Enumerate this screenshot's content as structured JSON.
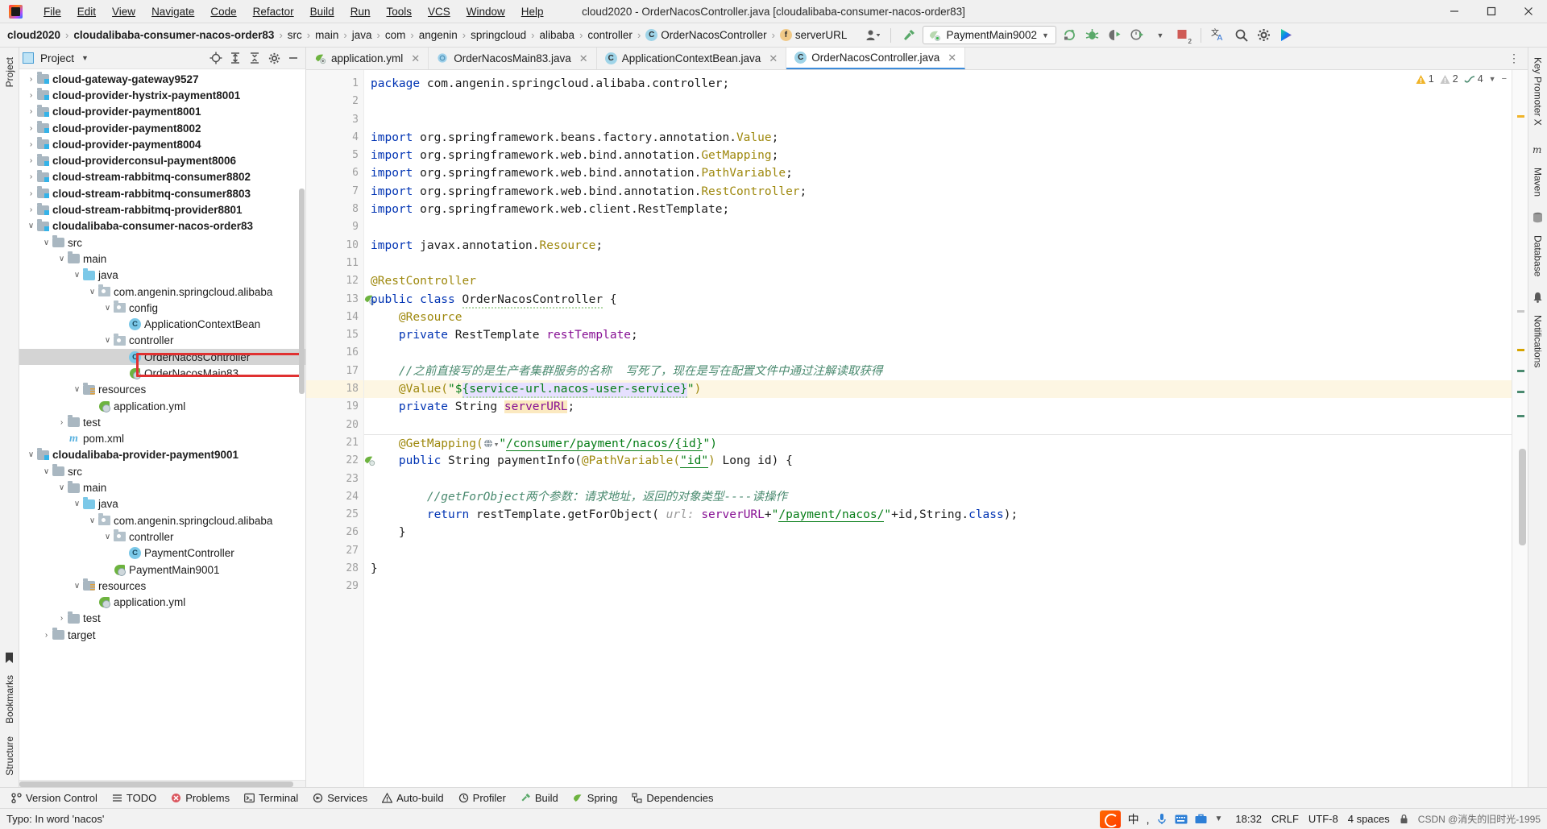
{
  "window": {
    "title": "cloud2020 - OrderNacosController.java [cloudalibaba-consumer-nacos-order83]",
    "minimize": "minimize-icon",
    "maximize": "maximize-icon",
    "close": "close-icon"
  },
  "menu": [
    {
      "label": "File"
    },
    {
      "label": "Edit"
    },
    {
      "label": "View"
    },
    {
      "label": "Navigate"
    },
    {
      "label": "Code"
    },
    {
      "label": "Refactor"
    },
    {
      "label": "Build"
    },
    {
      "label": "Run"
    },
    {
      "label": "Tools"
    },
    {
      "label": "VCS"
    },
    {
      "label": "Window"
    },
    {
      "label": "Help"
    }
  ],
  "breadcrumbs": [
    {
      "label": "cloud2020",
      "bold": true,
      "icon": ""
    },
    {
      "label": "cloudalibaba-consumer-nacos-order83",
      "bold": true,
      "icon": ""
    },
    {
      "label": "src",
      "bold": false,
      "icon": ""
    },
    {
      "label": "main",
      "bold": false,
      "icon": ""
    },
    {
      "label": "java",
      "bold": false,
      "icon": ""
    },
    {
      "label": "com",
      "bold": false,
      "icon": ""
    },
    {
      "label": "angenin",
      "bold": false,
      "icon": ""
    },
    {
      "label": "springcloud",
      "bold": false,
      "icon": ""
    },
    {
      "label": "alibaba",
      "bold": false,
      "icon": ""
    },
    {
      "label": "controller",
      "bold": false,
      "icon": ""
    },
    {
      "label": "OrderNacosController",
      "bold": false,
      "icon": "class-badge",
      "badge": "C"
    },
    {
      "label": "serverURL",
      "bold": false,
      "icon": "field-badge",
      "badge": "f"
    }
  ],
  "toolbar": {
    "run_config": "PaymentMain9002",
    "icons": [
      "user-avatar-icon",
      "hammer-build-icon",
      "rerun-icon",
      "debug-icon",
      "coverage-icon",
      "profiler-icon",
      "dropdown-arrow-icon",
      "stop-icon",
      "translate-icon",
      "search-icon",
      "settings-gear-icon",
      "ide-feature-icon"
    ],
    "stop_badge": "2"
  },
  "project_panel": {
    "title": "Project",
    "header_icons": [
      "locate-icon",
      "expand-all-icon",
      "collapse-all-icon",
      "settings-gear-icon",
      "hide-icon"
    ]
  },
  "tree": [
    {
      "depth": 1,
      "arrow": "›",
      "icon": "module-icon",
      "label": "cloud-gateway-gateway9527",
      "bold": true
    },
    {
      "depth": 1,
      "arrow": "›",
      "icon": "module-icon",
      "label": "cloud-provider-hystrix-payment8001",
      "bold": true
    },
    {
      "depth": 1,
      "arrow": "›",
      "icon": "module-icon",
      "label": "cloud-provider-payment8001",
      "bold": true
    },
    {
      "depth": 1,
      "arrow": "›",
      "icon": "module-icon",
      "label": "cloud-provider-payment8002",
      "bold": true
    },
    {
      "depth": 1,
      "arrow": "›",
      "icon": "module-icon",
      "label": "cloud-provider-payment8004",
      "bold": true
    },
    {
      "depth": 1,
      "arrow": "›",
      "icon": "module-icon",
      "label": "cloud-providerconsul-payment8006",
      "bold": true
    },
    {
      "depth": 1,
      "arrow": "›",
      "icon": "module-icon",
      "label": "cloud-stream-rabbitmq-consumer8802",
      "bold": true
    },
    {
      "depth": 1,
      "arrow": "›",
      "icon": "module-icon",
      "label": "cloud-stream-rabbitmq-consumer8803",
      "bold": true
    },
    {
      "depth": 1,
      "arrow": "›",
      "icon": "module-icon",
      "label": "cloud-stream-rabbitmq-provider8801",
      "bold": true
    },
    {
      "depth": 1,
      "arrow": "∨",
      "icon": "module-icon",
      "label": "cloudalibaba-consumer-nacos-order83",
      "bold": true
    },
    {
      "depth": 2,
      "arrow": "∨",
      "icon": "folder-icon",
      "label": "src",
      "bold": false
    },
    {
      "depth": 3,
      "arrow": "∨",
      "icon": "folder-icon",
      "label": "main",
      "bold": false
    },
    {
      "depth": 4,
      "arrow": "∨",
      "icon": "source-folder-icon",
      "label": "java",
      "bold": false
    },
    {
      "depth": 5,
      "arrow": "∨",
      "icon": "package-icon",
      "label": "com.angenin.springcloud.alibaba",
      "bold": false
    },
    {
      "depth": 6,
      "arrow": "∨",
      "icon": "package-icon",
      "label": "config",
      "bold": false
    },
    {
      "depth": 7,
      "arrow": "",
      "icon": "class-icon",
      "label": "ApplicationContextBean",
      "bold": false
    },
    {
      "depth": 6,
      "arrow": "∨",
      "icon": "package-icon",
      "label": "controller",
      "bold": false
    },
    {
      "depth": 7,
      "arrow": "",
      "icon": "class-icon",
      "label": "OrderNacosController",
      "bold": false,
      "selected": true,
      "highlighted": true
    },
    {
      "depth": 7,
      "arrow": "",
      "icon": "spring-class-icon",
      "label": "OrderNacosMain83",
      "bold": false
    },
    {
      "depth": 4,
      "arrow": "∨",
      "icon": "resource-folder-icon",
      "label": "resources",
      "bold": false
    },
    {
      "depth": 5,
      "arrow": "",
      "icon": "spring-yml-icon",
      "label": "application.yml",
      "bold": false
    },
    {
      "depth": 3,
      "arrow": "›",
      "icon": "folder-icon",
      "label": "test",
      "bold": false
    },
    {
      "depth": 3,
      "arrow": "",
      "icon": "maven-icon",
      "label": "pom.xml",
      "bold": false
    },
    {
      "depth": 1,
      "arrow": "∨",
      "icon": "module-icon",
      "label": "cloudalibaba-provider-payment9001",
      "bold": true
    },
    {
      "depth": 2,
      "arrow": "∨",
      "icon": "folder-icon",
      "label": "src",
      "bold": false
    },
    {
      "depth": 3,
      "arrow": "∨",
      "icon": "folder-icon",
      "label": "main",
      "bold": false
    },
    {
      "depth": 4,
      "arrow": "∨",
      "icon": "source-folder-icon",
      "label": "java",
      "bold": false
    },
    {
      "depth": 5,
      "arrow": "∨",
      "icon": "package-icon",
      "label": "com.angenin.springcloud.alibaba",
      "bold": false
    },
    {
      "depth": 6,
      "arrow": "∨",
      "icon": "package-icon",
      "label": "controller",
      "bold": false
    },
    {
      "depth": 7,
      "arrow": "",
      "icon": "class-icon",
      "label": "PaymentController",
      "bold": false
    },
    {
      "depth": 6,
      "arrow": "",
      "icon": "spring-class-icon",
      "label": "PaymentMain9001",
      "bold": false
    },
    {
      "depth": 4,
      "arrow": "∨",
      "icon": "resource-folder-icon",
      "label": "resources",
      "bold": false
    },
    {
      "depth": 5,
      "arrow": "",
      "icon": "spring-yml-icon",
      "label": "application.yml",
      "bold": false
    },
    {
      "depth": 3,
      "arrow": "›",
      "icon": "folder-icon",
      "label": "test",
      "bold": false
    },
    {
      "depth": 2,
      "arrow": "›",
      "icon": "folder-icon",
      "label": "target",
      "bold": false
    }
  ],
  "editor_tabs": [
    {
      "label": "application.yml",
      "icon": "spring-yml-icon",
      "active": false
    },
    {
      "label": "OrderNacosMain83.java",
      "icon": "spring-class-icon",
      "active": false
    },
    {
      "label": "ApplicationContextBean.java",
      "icon": "class-icon",
      "active": false
    },
    {
      "label": "OrderNacosController.java",
      "icon": "class-icon",
      "active": true
    }
  ],
  "analysis": {
    "warnings": "1",
    "weak_warnings": "2",
    "typos": "4"
  },
  "code": {
    "lines": [
      {
        "n": "1",
        "indent": 0,
        "gutter": "",
        "tokens": [
          {
            "t": "package ",
            "c": "k"
          },
          {
            "t": "com.angenin.springcloud.alibaba.controller;",
            "c": ""
          }
        ]
      },
      {
        "n": "2",
        "indent": 0,
        "gutter": "",
        "tokens": []
      },
      {
        "n": "3",
        "indent": 0,
        "gutter": "",
        "tokens": []
      },
      {
        "n": "4",
        "indent": 0,
        "gutter": "fold",
        "tokens": [
          {
            "t": "import ",
            "c": "k"
          },
          {
            "t": "org.springframework.beans.factory.annotation.",
            "c": ""
          },
          {
            "t": "Value",
            "c": "goldc"
          },
          {
            "t": ";",
            "c": ""
          }
        ]
      },
      {
        "n": "5",
        "indent": 0,
        "gutter": "",
        "tokens": [
          {
            "t": "import ",
            "c": "k"
          },
          {
            "t": "org.springframework.web.bind.annotation.",
            "c": ""
          },
          {
            "t": "GetMapping",
            "c": "goldc"
          },
          {
            "t": ";",
            "c": ""
          }
        ]
      },
      {
        "n": "6",
        "indent": 0,
        "gutter": "",
        "tokens": [
          {
            "t": "import ",
            "c": "k"
          },
          {
            "t": "org.springframework.web.bind.annotation.",
            "c": ""
          },
          {
            "t": "PathVariable",
            "c": "goldc"
          },
          {
            "t": ";",
            "c": ""
          }
        ]
      },
      {
        "n": "7",
        "indent": 0,
        "gutter": "",
        "tokens": [
          {
            "t": "import ",
            "c": "k"
          },
          {
            "t": "org.springframework.web.bind.annotation.",
            "c": ""
          },
          {
            "t": "RestController",
            "c": "goldc"
          },
          {
            "t": ";",
            "c": ""
          }
        ]
      },
      {
        "n": "8",
        "indent": 0,
        "gutter": "",
        "tokens": [
          {
            "t": "import ",
            "c": "k"
          },
          {
            "t": "org.springframework.web.client.RestTemplate;",
            "c": ""
          }
        ]
      },
      {
        "n": "9",
        "indent": 0,
        "gutter": "",
        "tokens": []
      },
      {
        "n": "10",
        "indent": 0,
        "gutter": "fold",
        "tokens": [
          {
            "t": "import ",
            "c": "k"
          },
          {
            "t": "javax.annotation.",
            "c": ""
          },
          {
            "t": "Resource",
            "c": "goldc"
          },
          {
            "t": ";",
            "c": ""
          }
        ]
      },
      {
        "n": "11",
        "indent": 0,
        "gutter": "",
        "tokens": []
      },
      {
        "n": "12",
        "indent": 0,
        "gutter": "",
        "tokens": [
          {
            "t": "@RestController",
            "c": "ann"
          }
        ]
      },
      {
        "n": "13",
        "indent": 0,
        "gutter": "spring",
        "tokens": [
          {
            "t": "public ",
            "c": "k"
          },
          {
            "t": "class ",
            "c": "k"
          },
          {
            "t": "OrderNacosController",
            "c": "wavy"
          },
          {
            "t": " {",
            "c": ""
          }
        ]
      },
      {
        "n": "14",
        "indent": 1,
        "gutter": "",
        "tokens": [
          {
            "t": "@Resource",
            "c": "ann"
          }
        ]
      },
      {
        "n": "15",
        "indent": 1,
        "gutter": "",
        "tokens": [
          {
            "t": "private ",
            "c": "k"
          },
          {
            "t": "RestTemplate ",
            "c": ""
          },
          {
            "t": "restTemplate",
            "c": "fld"
          },
          {
            "t": ";",
            "c": ""
          }
        ]
      },
      {
        "n": "16",
        "indent": 0,
        "gutter": "",
        "tokens": []
      },
      {
        "n": "17",
        "indent": 1,
        "gutter": "",
        "tokens": [
          {
            "t": "//之前直接写的是生产者集群服务的名称  写死了，现在是写在配置文件中通过注解读取获得",
            "c": "cmtz"
          }
        ]
      },
      {
        "n": "18",
        "indent": 1,
        "gutter": "bulb",
        "hl": true,
        "tokens": [
          {
            "t": "@Value(",
            "c": "ann"
          },
          {
            "t": "\"$",
            "c": "str"
          },
          {
            "t": "{service-url.nacos-user-service}",
            "c": "selpurple"
          },
          {
            "t": "\"",
            "c": "str"
          },
          {
            "t": ")",
            "c": "ann"
          }
        ]
      },
      {
        "n": "19",
        "indent": 1,
        "gutter": "",
        "tokens": [
          {
            "t": "private ",
            "c": "k"
          },
          {
            "t": "String ",
            "c": ""
          },
          {
            "t": "serverURL",
            "c": "selamber"
          },
          {
            "t": ";",
            "c": ""
          }
        ]
      },
      {
        "n": "20",
        "indent": 0,
        "gutter": "",
        "tokens": []
      },
      {
        "n": "21",
        "indent": 1,
        "gutter": "",
        "tokens": [
          {
            "t": "@GetMapping(",
            "c": "ann"
          },
          {
            "t": "GLOBE",
            "c": "globe"
          },
          {
            "t": "\"",
            "c": "str"
          },
          {
            "t": "/consumer/payment/nacos/{id}",
            "c": "strlink"
          },
          {
            "t": "\")",
            "c": "str"
          }
        ]
      },
      {
        "n": "22",
        "indent": 1,
        "gutter": "spring-fold",
        "tokens": [
          {
            "t": "public ",
            "c": "k"
          },
          {
            "t": "String ",
            "c": ""
          },
          {
            "t": "paymentInfo",
            "c": ""
          },
          {
            "t": "(",
            "c": ""
          },
          {
            "t": "@PathVariable(",
            "c": "ann"
          },
          {
            "t": "\"id\"",
            "c": "strid"
          },
          {
            "t": ")",
            "c": "ann"
          },
          {
            "t": " Long id) {",
            "c": ""
          }
        ]
      },
      {
        "n": "23",
        "indent": 0,
        "gutter": "",
        "tokens": []
      },
      {
        "n": "24",
        "indent": 2,
        "gutter": "",
        "tokens": [
          {
            "t": "//getForObject两个参数：请求地址，返回的对象类型----读操作",
            "c": "cmtz"
          }
        ]
      },
      {
        "n": "25",
        "indent": 2,
        "gutter": "",
        "tokens": [
          {
            "t": "return ",
            "c": "k"
          },
          {
            "t": "restTemplate",
            "c": ""
          },
          {
            "t": ".getForObject(",
            "c": ""
          },
          {
            "t": " url: ",
            "c": "hint"
          },
          {
            "t": "serverURL",
            "c": "fld"
          },
          {
            "t": "+",
            "c": ""
          },
          {
            "t": "\"",
            "c": "str"
          },
          {
            "t": "/payment/nacos/",
            "c": "strlink"
          },
          {
            "t": "\"",
            "c": "str"
          },
          {
            "t": "+id,String.",
            "c": ""
          },
          {
            "t": "class",
            "c": "k"
          },
          {
            "t": ");",
            "c": ""
          }
        ]
      },
      {
        "n": "26",
        "indent": 1,
        "gutter": "fold2",
        "tokens": [
          {
            "t": "}",
            "c": ""
          }
        ]
      },
      {
        "n": "27",
        "indent": 0,
        "gutter": "",
        "tokens": []
      },
      {
        "n": "28",
        "indent": 0,
        "gutter": "",
        "tokens": [
          {
            "t": "}",
            "c": ""
          }
        ]
      },
      {
        "n": "29",
        "indent": 0,
        "gutter": "",
        "tokens": []
      }
    ]
  },
  "tool_windows": [
    {
      "label": "Version Control",
      "icon": "branch-icon"
    },
    {
      "label": "TODO",
      "icon": "list-icon"
    },
    {
      "label": "Problems",
      "icon": "error-icon"
    },
    {
      "label": "Terminal",
      "icon": "terminal-icon"
    },
    {
      "label": "Services",
      "icon": "services-icon"
    },
    {
      "label": "Auto-build",
      "icon": "warning-icon"
    },
    {
      "label": "Profiler",
      "icon": "profiler-icon"
    },
    {
      "label": "Build",
      "icon": "build-icon"
    },
    {
      "label": "Spring",
      "icon": "spring-icon"
    },
    {
      "label": "Dependencies",
      "icon": "dependencies-icon"
    }
  ],
  "right_rail": [
    {
      "label": "Key Promoter X"
    },
    {
      "label": "Maven"
    },
    {
      "label": "Database"
    },
    {
      "label": "Notifications"
    }
  ],
  "left_rail": [
    {
      "label": "Project"
    },
    {
      "label": "Bookmarks"
    },
    {
      "label": "Structure"
    }
  ],
  "statusbar": {
    "message": "Typo: In word 'nacos'",
    "time": "18:32",
    "line_sep": "CRLF",
    "encoding": "UTF-8",
    "indent": "4 spaces",
    "lock": "lock-icon",
    "watermark": "CSDN @消失的旧时光-1995"
  },
  "colors": {
    "accent_blue": "#3c8cdb",
    "annotation_red": "#e03131",
    "keyword": "#0033b3",
    "string": "#067d17",
    "annotation_gold": "#9e880d",
    "field_purple": "#871094",
    "comment_green": "#4a8a6f",
    "highlight_line": "#fdf6e3",
    "selection_purple": "#e6e0ff",
    "selection_amber": "#fbe9c0"
  }
}
